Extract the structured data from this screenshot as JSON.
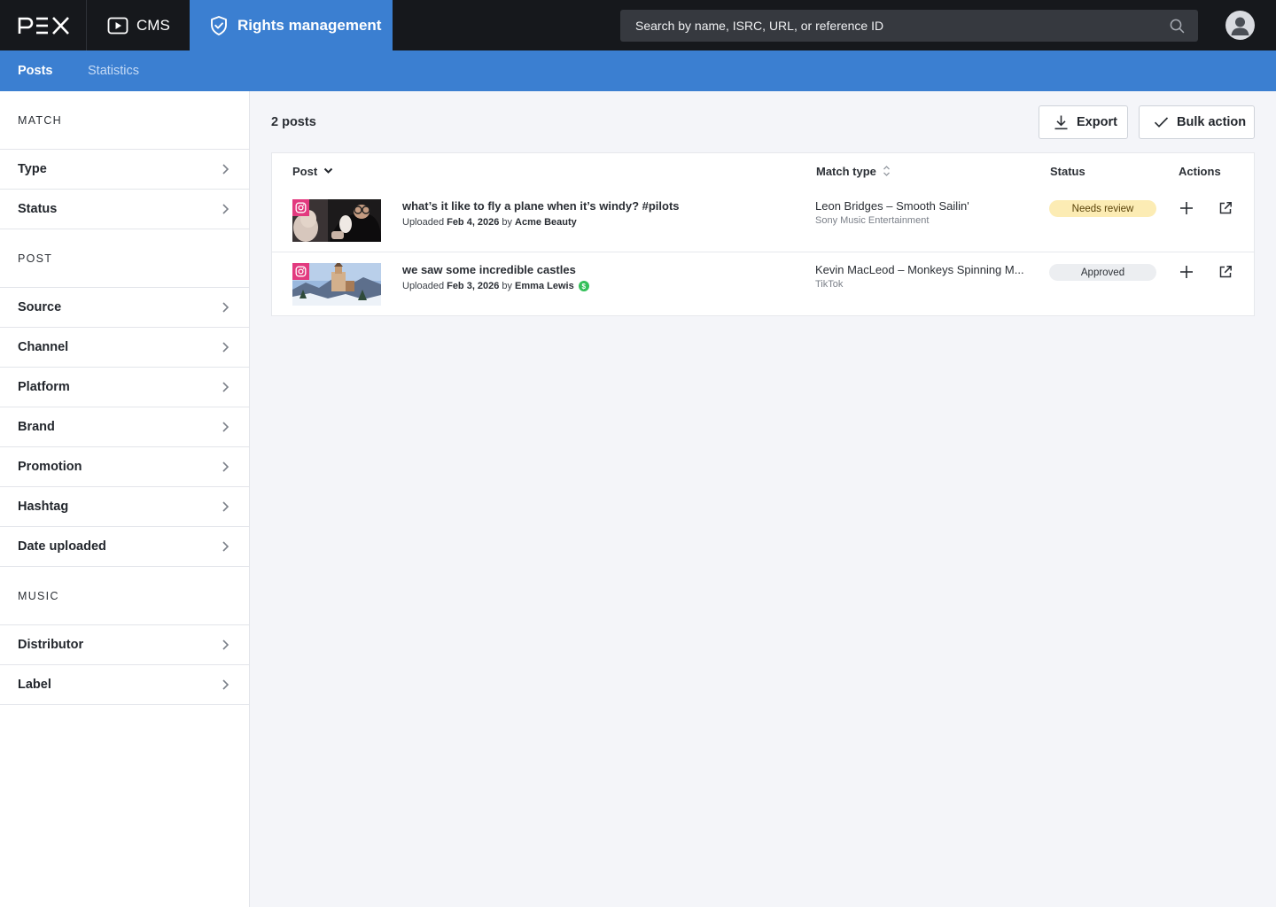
{
  "app": {
    "logo": "pex",
    "nav": {
      "cms_label": "CMS",
      "rights_label": "Rights management"
    },
    "search": {
      "placeholder": "Search by name, ISRC, URL, or reference ID"
    }
  },
  "subnav": {
    "tabs": [
      {
        "label": "Posts",
        "active": true
      },
      {
        "label": "Statistics",
        "active": false
      }
    ]
  },
  "sidebar": {
    "sections": [
      {
        "title": "MATCH",
        "items": [
          "Type",
          "Status"
        ]
      },
      {
        "title": "POST",
        "items": [
          "Source",
          "Channel",
          "Platform",
          "Brand",
          "Promotion",
          "Hashtag",
          "Date uploaded"
        ]
      },
      {
        "title": "MUSIC",
        "items": [
          "Distributor",
          "Label"
        ]
      }
    ]
  },
  "main": {
    "count": "2 posts",
    "export_label": "Export",
    "bulk_label": "Bulk action",
    "columns": {
      "post": "Post",
      "match_type": "Match type",
      "status": "Status",
      "actions": "Actions"
    },
    "rows": [
      {
        "title": "what’s it like to fly a plane when it’s windy? #pilots",
        "uploaded_prefix": "Uploaded",
        "date": "Feb 4, 2026",
        "by_prefix": "by",
        "uploader": "Acme Beauty",
        "match_title": "Leon Bridges – Smooth Sailin'",
        "match_sub": "Sony Music Entertainment",
        "status": "Needs review",
        "platform_icon": "instagram-icon"
      },
      {
        "title": "we saw some incredible castles",
        "uploaded_prefix": "Uploaded",
        "date": "Feb 3, 2026",
        "by_prefix": "by",
        "uploader": "Emma Lewis",
        "monetized_symbol": "$",
        "match_title": "Kevin MacLeod – Monkeys Spinning M...",
        "match_sub": "TikTok",
        "status": "Approved",
        "platform_icon": "instagram-icon"
      }
    ]
  },
  "colors": {
    "topbar": "#16181c",
    "accent": "#3b7fd1",
    "review_badge": "#fcecb4",
    "approved_badge": "#eceef1",
    "instagram": "#e23a7f",
    "monetized": "#34c05a"
  }
}
